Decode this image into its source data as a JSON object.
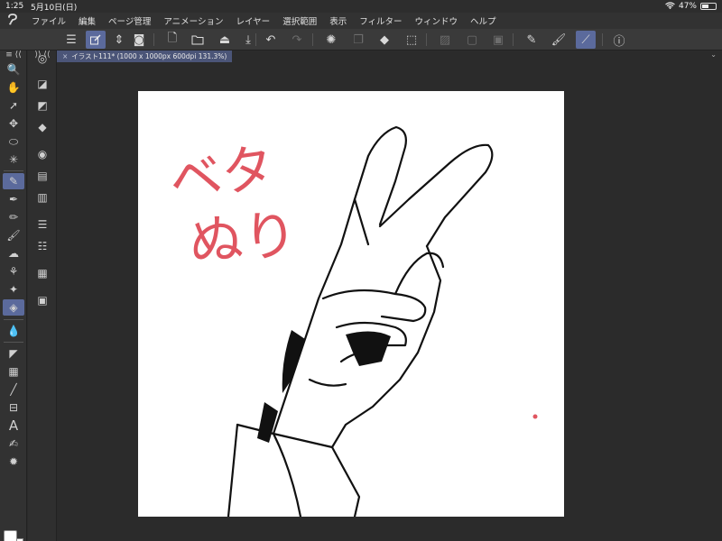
{
  "status": {
    "time": "1:25",
    "date": "5月10日(日)",
    "battery": "47%",
    "battery_level": 0.47
  },
  "menu": [
    "ファイル",
    "編集",
    "ページ管理",
    "アニメーション",
    "レイヤー",
    "選択範囲",
    "表示",
    "フィルター",
    "ウィンドウ",
    "ヘルプ"
  ],
  "document": {
    "tab_label": "イラスト111* (1000 x 1000px 600dpi 131.3%)",
    "close_glyph": "×"
  },
  "artwork": {
    "text_line1": "ベタ",
    "text_line2": "ぬり",
    "text_color": "#e05560"
  },
  "colors": {
    "accent": "#5b6a9c",
    "main_color": "#ffffff",
    "sub_color": "#ffffff"
  }
}
